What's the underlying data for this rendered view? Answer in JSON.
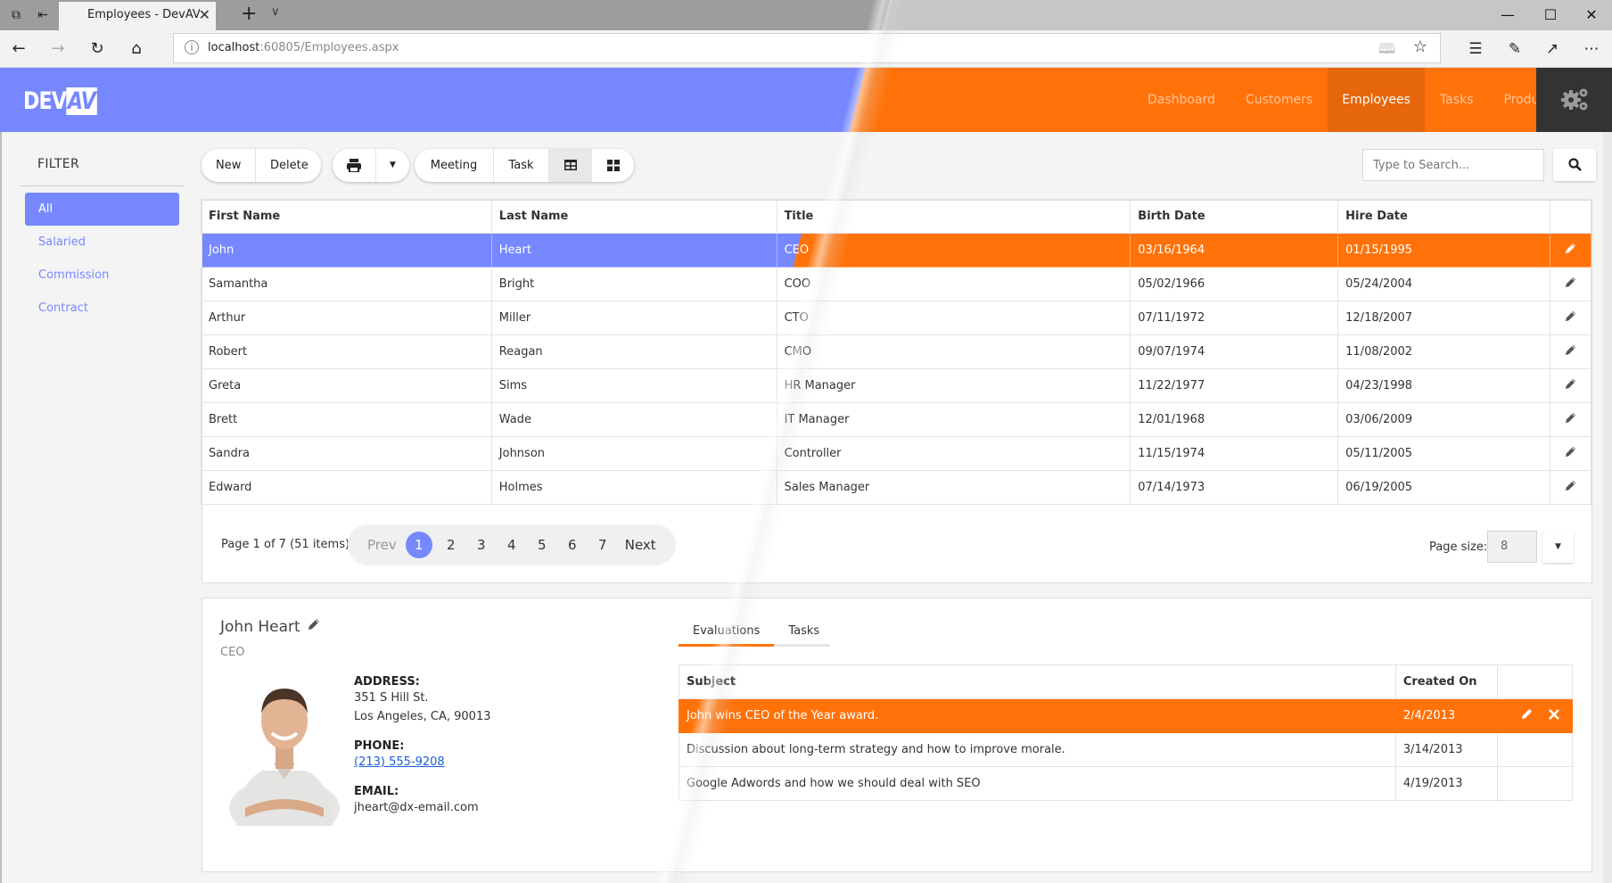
{
  "browser": {
    "tab_title": "Employees - DevAV Boc",
    "url_host": "localhost",
    "url_rest": ":60805/Employees.aspx"
  },
  "app": {
    "logo_left": "DEV",
    "logo_right": "AV",
    "nav": [
      {
        "label": "Dashboard",
        "active": false
      },
      {
        "label": "Customers",
        "active": false
      },
      {
        "label": "Employees",
        "active": true
      },
      {
        "label": "Tasks",
        "active": false
      },
      {
        "label": "Products",
        "active": false
      }
    ],
    "colors": {
      "blue_accent": "#7788ff",
      "orange_accent": "#ff7209",
      "nav_dark": "#333333"
    }
  },
  "filter": {
    "title": "FILTER",
    "items": [
      {
        "label": "All",
        "active": true
      },
      {
        "label": "Salaried",
        "active": false
      },
      {
        "label": "Commission",
        "active": false
      },
      {
        "label": "Contract",
        "active": false
      }
    ]
  },
  "toolbar": {
    "new": "New",
    "delete": "Delete",
    "meeting": "Meeting",
    "task": "Task",
    "search_placeholder": "Type to Search..."
  },
  "grid": {
    "columns": [
      "First Name",
      "Last Name",
      "Title",
      "Birth Date",
      "Hire Date"
    ],
    "rows": [
      {
        "first": "John",
        "last": "Heart",
        "title": "CEO",
        "birth": "03/16/1964",
        "hire": "01/15/1995",
        "selected": true
      },
      {
        "first": "Samantha",
        "last": "Bright",
        "title": "COO",
        "birth": "05/02/1966",
        "hire": "05/24/2004"
      },
      {
        "first": "Arthur",
        "last": "Miller",
        "title": "CTO",
        "birth": "07/11/1972",
        "hire": "12/18/2007"
      },
      {
        "first": "Robert",
        "last": "Reagan",
        "title": "CMO",
        "birth": "09/07/1974",
        "hire": "11/08/2002"
      },
      {
        "first": "Greta",
        "last": "Sims",
        "title": "HR Manager",
        "birth": "11/22/1977",
        "hire": "04/23/1998"
      },
      {
        "first": "Brett",
        "last": "Wade",
        "title": "IT Manager",
        "birth": "12/01/1968",
        "hire": "03/06/2009"
      },
      {
        "first": "Sandra",
        "last": "Johnson",
        "title": "Controller",
        "birth": "11/15/1974",
        "hire": "05/11/2005"
      },
      {
        "first": "Edward",
        "last": "Holmes",
        "title": "Sales Manager",
        "birth": "07/14/1973",
        "hire": "06/19/2005"
      }
    ]
  },
  "pager": {
    "info": "Page 1 of 7 (51 items)",
    "prev": "Prev",
    "next": "Next",
    "pages": [
      "1",
      "2",
      "3",
      "4",
      "5",
      "6",
      "7"
    ],
    "current": "1",
    "page_size_label": "Page size:",
    "page_size": "8"
  },
  "detail": {
    "name": "John Heart",
    "title": "CEO",
    "address_label": "ADDRESS:",
    "address_line1": "351 S Hill St.",
    "address_line2": "Los Angeles, CA, 90013",
    "phone_label": "PHONE:",
    "phone": "(213) 555-9208",
    "email_label": "EMAIL:",
    "email": "jheart@dx-email.com",
    "tabs": [
      {
        "label": "Evaluations",
        "active": true
      },
      {
        "label": "Tasks",
        "active": false
      }
    ],
    "eval_columns": [
      "Subject",
      "Created On"
    ],
    "evaluations": [
      {
        "subject": "John wins CEO of the Year award.",
        "created": "2/4/2013",
        "selected": true
      },
      {
        "subject": "Discussion about long-term strategy and how to improve morale.",
        "created": "3/14/2013"
      },
      {
        "subject": "Google Adwords and how we should deal with SEO",
        "created": "4/19/2013"
      }
    ]
  }
}
